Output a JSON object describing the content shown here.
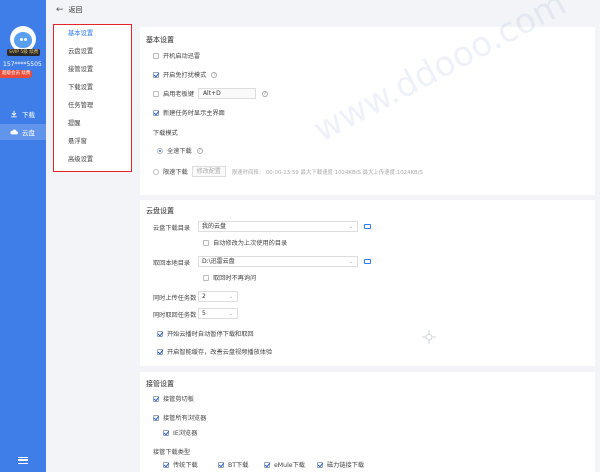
{
  "app": {
    "vip_badge": "SVIP 5级 续费",
    "phone": "157****5505",
    "open_vip": "超级会员 续费",
    "nav": [
      {
        "label": "下载",
        "icon": "download-icon"
      },
      {
        "label": "云盘",
        "icon": "cloud-icon"
      }
    ],
    "menu_icon": "hamburger-icon",
    "accent": "#3f7ee8"
  },
  "topbar": {
    "back_label": "返回"
  },
  "categories": [
    "基本设置",
    "云盘设置",
    "接管设置",
    "下载设置",
    "任务管理",
    "提醒",
    "悬浮窗",
    "高级设置"
  ],
  "basic": {
    "title": "基本设置",
    "autostart": "开机启动迅雷",
    "free_mode": "开启免打扰模式",
    "boss_key": "启用老板键",
    "boss_key_value": "Alt+D",
    "show_main": "新建任务时显示主界面",
    "download_mode": "下载模式",
    "full_speed": "全速下载",
    "limited": "限速下载",
    "modify_config": "修改配置",
    "limit_info": "限速时间段：  00:00-23:59   最大下载速度:1024KB/S     最大上传速度:1024KB/S"
  },
  "cloud": {
    "title": "云盘设置",
    "download_dir_label": "云盘下载目录",
    "download_dir_value": "我的云盘",
    "auto_modify": "自动修改为上次使用的目录",
    "fetch_dir_label": "取回本地目录",
    "fetch_dir_value": "D:\\迅雷云盘",
    "no_ask": "取回时不再询问",
    "upload_count_label": "同时上传任务数",
    "upload_count": "2",
    "fetch_count_label": "同时取回任务数",
    "fetch_count": "5",
    "auto_pause": "开始云播时自动暂停下载和取回",
    "smart_cache": "开启智能缓存，改善云盘视频播放体验"
  },
  "takeover": {
    "title": "接管设置",
    "clipboard": "接管剪切板",
    "all_browsers": "接管所有浏览器",
    "ie": "IE浏览器",
    "types_label": "接管下载类型",
    "types": [
      "传统下载",
      "BT下载",
      "eMule下载",
      "磁力链接下载"
    ]
  },
  "watermark": "www.ddooo.com"
}
